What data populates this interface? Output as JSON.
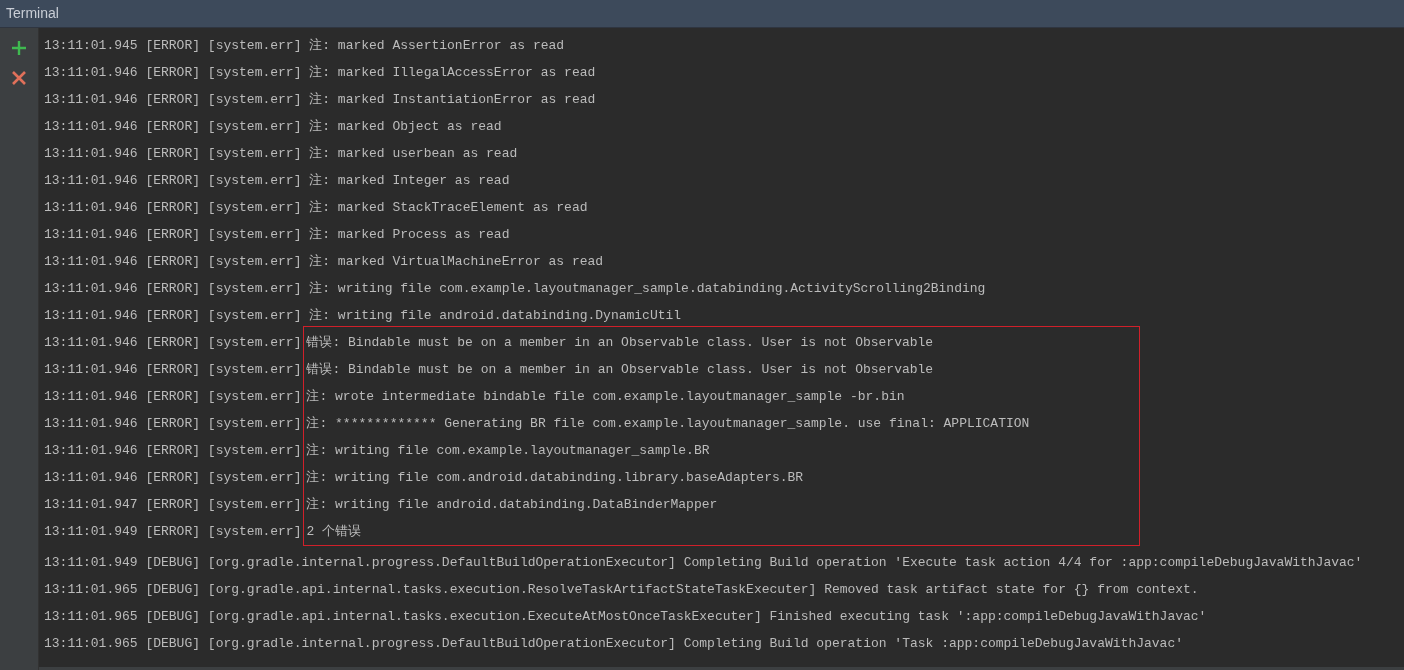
{
  "window": {
    "title": "Terminal"
  },
  "toolbar": [
    {
      "kind": "add"
    },
    {
      "kind": "close"
    }
  ],
  "blocks": [
    {
      "kind": "plain",
      "lines": [
        "13:11:01.945 [ERROR] [system.err] 注: marked AssertionError as read",
        "13:11:01.946 [ERROR] [system.err] 注: marked IllegalAccessError as read",
        "13:11:01.946 [ERROR] [system.err] 注: marked InstantiationError as read",
        "13:11:01.946 [ERROR] [system.err] 注: marked Object as read",
        "13:11:01.946 [ERROR] [system.err] 注: marked userbean as read",
        "13:11:01.946 [ERROR] [system.err] 注: marked Integer as read",
        "13:11:01.946 [ERROR] [system.err] 注: marked StackTraceElement as read",
        "13:11:01.946 [ERROR] [system.err] 注: marked Process as read",
        "13:11:01.946 [ERROR] [system.err] 注: marked VirtualMachineError as read",
        "13:11:01.946 [ERROR] [system.err] 注: writing file com.example.layoutmanager_sample.databinding.ActivityScrolling2Binding",
        "13:11:01.946 [ERROR] [system.err] 注: writing file android.databinding.DynamicUtil"
      ]
    },
    {
      "kind": "boxed",
      "lines": [
        {
          "prefix": "13:11:01.946 [ERROR] [system.err]",
          "message": "错误: Bindable must be on a member in an Observable class. User is not Observable"
        },
        {
          "prefix": "13:11:01.946 [ERROR] [system.err]",
          "message": "错误: Bindable must be on a member in an Observable class. User is not Observable"
        },
        {
          "prefix": "13:11:01.946 [ERROR] [system.err]",
          "message": "注: wrote intermediate bindable file com.example.layoutmanager_sample -br.bin"
        },
        {
          "prefix": "13:11:01.946 [ERROR] [system.err]",
          "message": "注: ************* Generating BR file com.example.layoutmanager_sample. use final: APPLICATION"
        },
        {
          "prefix": "13:11:01.946 [ERROR] [system.err]",
          "message": "注: writing file com.example.layoutmanager_sample.BR"
        },
        {
          "prefix": "13:11:01.946 [ERROR] [system.err]",
          "message": "注: writing file com.android.databinding.library.baseAdapters.BR"
        },
        {
          "prefix": "13:11:01.947 [ERROR] [system.err]",
          "message": "注: writing file android.databinding.DataBinderMapper"
        },
        {
          "prefix": "13:11:01.949 [ERROR] [system.err]",
          "message": "2 个错误"
        }
      ]
    },
    {
      "kind": "plain",
      "lines": [
        "13:11:01.949 [DEBUG] [org.gradle.internal.progress.DefaultBuildOperationExecutor] Completing Build operation 'Execute task action 4/4 for :app:compileDebugJavaWithJavac'",
        "13:11:01.965 [DEBUG] [org.gradle.api.internal.tasks.execution.ResolveTaskArtifactStateTaskExecuter] Removed task artifact state for {} from context.",
        "13:11:01.965 [DEBUG] [org.gradle.api.internal.tasks.execution.ExecuteAtMostOnceTaskExecuter] Finished executing task ':app:compileDebugJavaWithJavac'",
        "13:11:01.965 [DEBUG] [org.gradle.internal.progress.DefaultBuildOperationExecutor] Completing Build operation 'Task :app:compileDebugJavaWithJavac'"
      ]
    }
  ]
}
